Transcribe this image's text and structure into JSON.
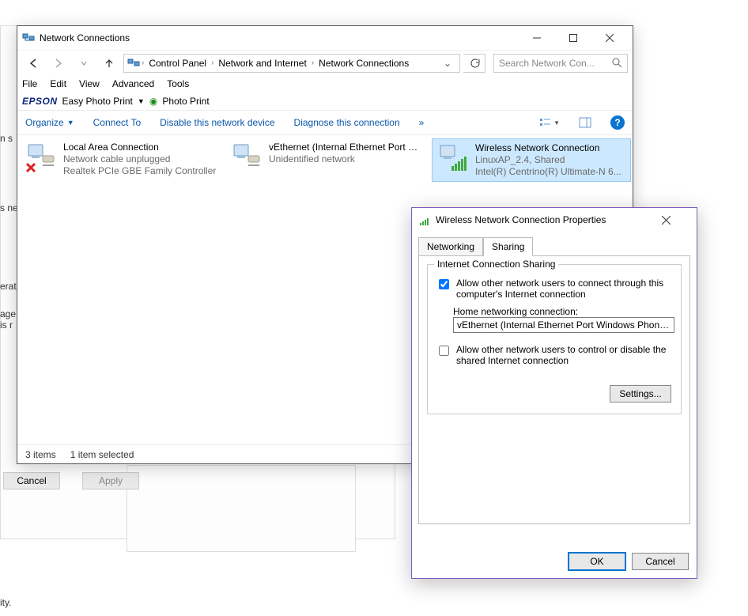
{
  "explorer": {
    "title": "Network Connections",
    "breadcrumbs": [
      "Control Panel",
      "Network and Internet",
      "Network Connections"
    ],
    "search_placeholder": "Search Network Con...",
    "menu": [
      "File",
      "Edit",
      "View",
      "Advanced",
      "Tools"
    ],
    "epson": {
      "brand": "EPSON",
      "label": "Easy Photo Print",
      "photo_print": "Photo Print"
    },
    "cmd": {
      "organize": "Organize",
      "connect": "Connect To",
      "disable": "Disable this network device",
      "diagnose": "Diagnose this connection"
    },
    "connections": [
      {
        "name": "Local Area Connection",
        "line2": "Network cable unplugged",
        "line3": "Realtek PCIe GBE Family Controller",
        "state": "unplugged",
        "selected": false
      },
      {
        "name": "vEthernet (Internal Ethernet Port Windows Phone Emulator Interna...",
        "line2": "Unidentified network",
        "line3": "",
        "state": "unknown",
        "selected": false
      },
      {
        "name": "Wireless Network Connection",
        "line2": "LinuxAP_2.4, Shared",
        "line3": "Intel(R) Centrino(R) Ultimate-N 6...",
        "state": "wireless",
        "selected": true
      }
    ],
    "status": {
      "items": "3 items",
      "selected": "1 item selected"
    }
  },
  "props": {
    "title": "Wireless Network Connection Properties",
    "tabs": [
      "Networking",
      "Sharing"
    ],
    "active_tab": "Sharing",
    "group_label": "Internet Connection Sharing",
    "cb1": {
      "checked": true,
      "label": "Allow other network users to connect through this computer's Internet connection"
    },
    "home_label": "Home networking connection:",
    "home_value": "vEthernet (Internal Ethernet Port Windows Phone Emulator",
    "cb2": {
      "checked": false,
      "label": "Allow other network users to control or disable the shared Internet connection"
    },
    "settings_btn": "Settings...",
    "ok": "OK",
    "cancel": "Cancel"
  },
  "bg_buttons": {
    "cancel": "Cancel",
    "apply": "Apply"
  },
  "slivers": {
    "s1": "n s",
    "s2": "s ne",
    "s3": "erati",
    "s4": "age",
    "s5": "is r",
    "s6": "ity."
  }
}
